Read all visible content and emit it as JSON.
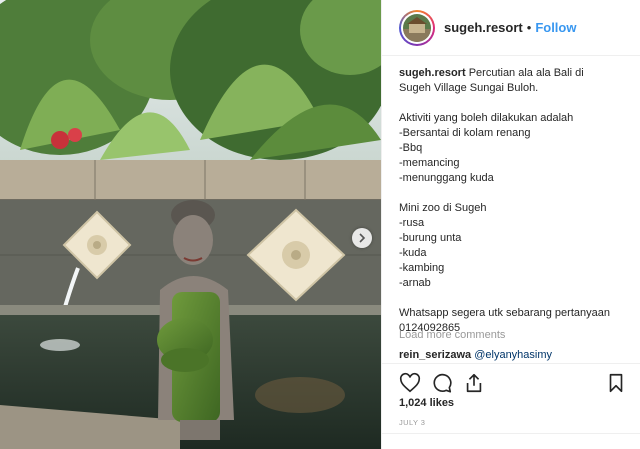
{
  "header": {
    "username": "sugeh.resort",
    "separator": "•",
    "follow_label": "Follow"
  },
  "caption": {
    "username": "sugeh.resort",
    "lines": [
      "Percutian ala ala Bali di",
      "Sugeh Village Sungai Buloh.",
      "",
      "Aktiviti yang boleh dilakukan adalah",
      "-Bersantai di kolam renang",
      "-Bbq",
      "-memancing",
      "-menunggang kuda",
      "",
      "Mini zoo di Sugeh",
      "-rusa",
      "-burung unta",
      "-kuda",
      "-kambing",
      "-arnab",
      "",
      "Whatsapp segera utk sebarang pertanyaan",
      "0124092865"
    ]
  },
  "comments": {
    "load_more_label": "Load more comments",
    "items": [
      {
        "username": "rein_serizawa",
        "text": "@elyanyhasimy"
      }
    ]
  },
  "actions": {
    "like_icon": "heart-icon",
    "comment_icon": "comment-bubble-icon",
    "share_icon": "share-icon",
    "save_icon": "bookmark-icon"
  },
  "likes_label": "1,024 likes",
  "date_label": "JULY 3",
  "colors": {
    "follow": "#3897f0",
    "text": "#262626",
    "muted": "#999999",
    "mention": "#003569",
    "border": "#efefef"
  }
}
